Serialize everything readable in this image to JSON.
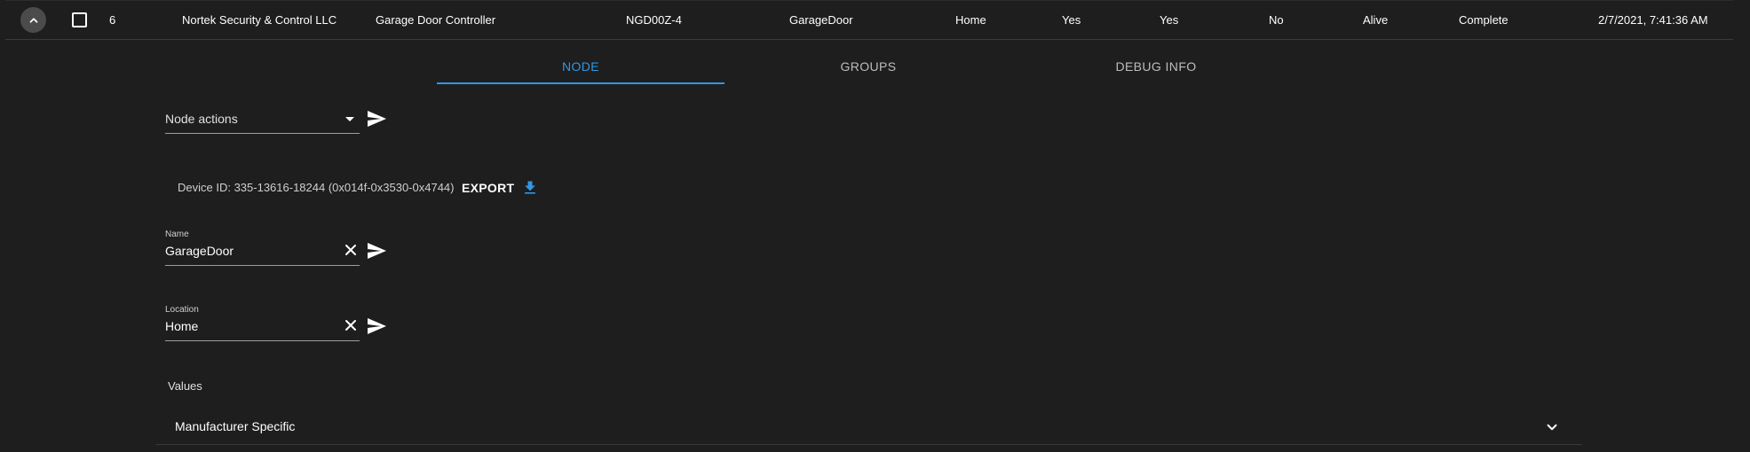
{
  "node_row": {
    "id": "6",
    "manufacturer": "Nortek Security & Control LLC",
    "product": "Garage Door Controller",
    "product_code": "NGD00Z-4",
    "name": "GarageDoor",
    "location": "Home",
    "secure": "Yes",
    "beaming": "Yes",
    "failed": "No",
    "status": "Alive",
    "interview_stage": "Complete",
    "last_active": "2/7/2021, 7:41:36 AM"
  },
  "tabs": [
    {
      "label": "NODE",
      "active": true
    },
    {
      "label": "GROUPS",
      "active": false
    },
    {
      "label": "DEBUG INFO",
      "active": false
    }
  ],
  "node_actions": {
    "label": "Node actions"
  },
  "device_id": "Device ID: 335-13616-18244 (0x014f-0x3530-0x4744)",
  "export": {
    "label": "EXPORT"
  },
  "name_field": {
    "label": "Name",
    "value": "GarageDoor"
  },
  "location_field": {
    "label": "Location",
    "value": "Home"
  },
  "values": {
    "heading": "Values",
    "sections": [
      {
        "title": "Manufacturer Specific"
      }
    ]
  },
  "colors": {
    "accent": "#2f97e6",
    "background": "#1e1e1e",
    "expand_button": "#4b4b4b"
  },
  "icons": {
    "expand": "chevron-up-icon",
    "select": "checkbox-icon",
    "send": "send-icon",
    "export": "download-icon",
    "clear": "close-icon",
    "accordion": "chevron-down-icon"
  }
}
